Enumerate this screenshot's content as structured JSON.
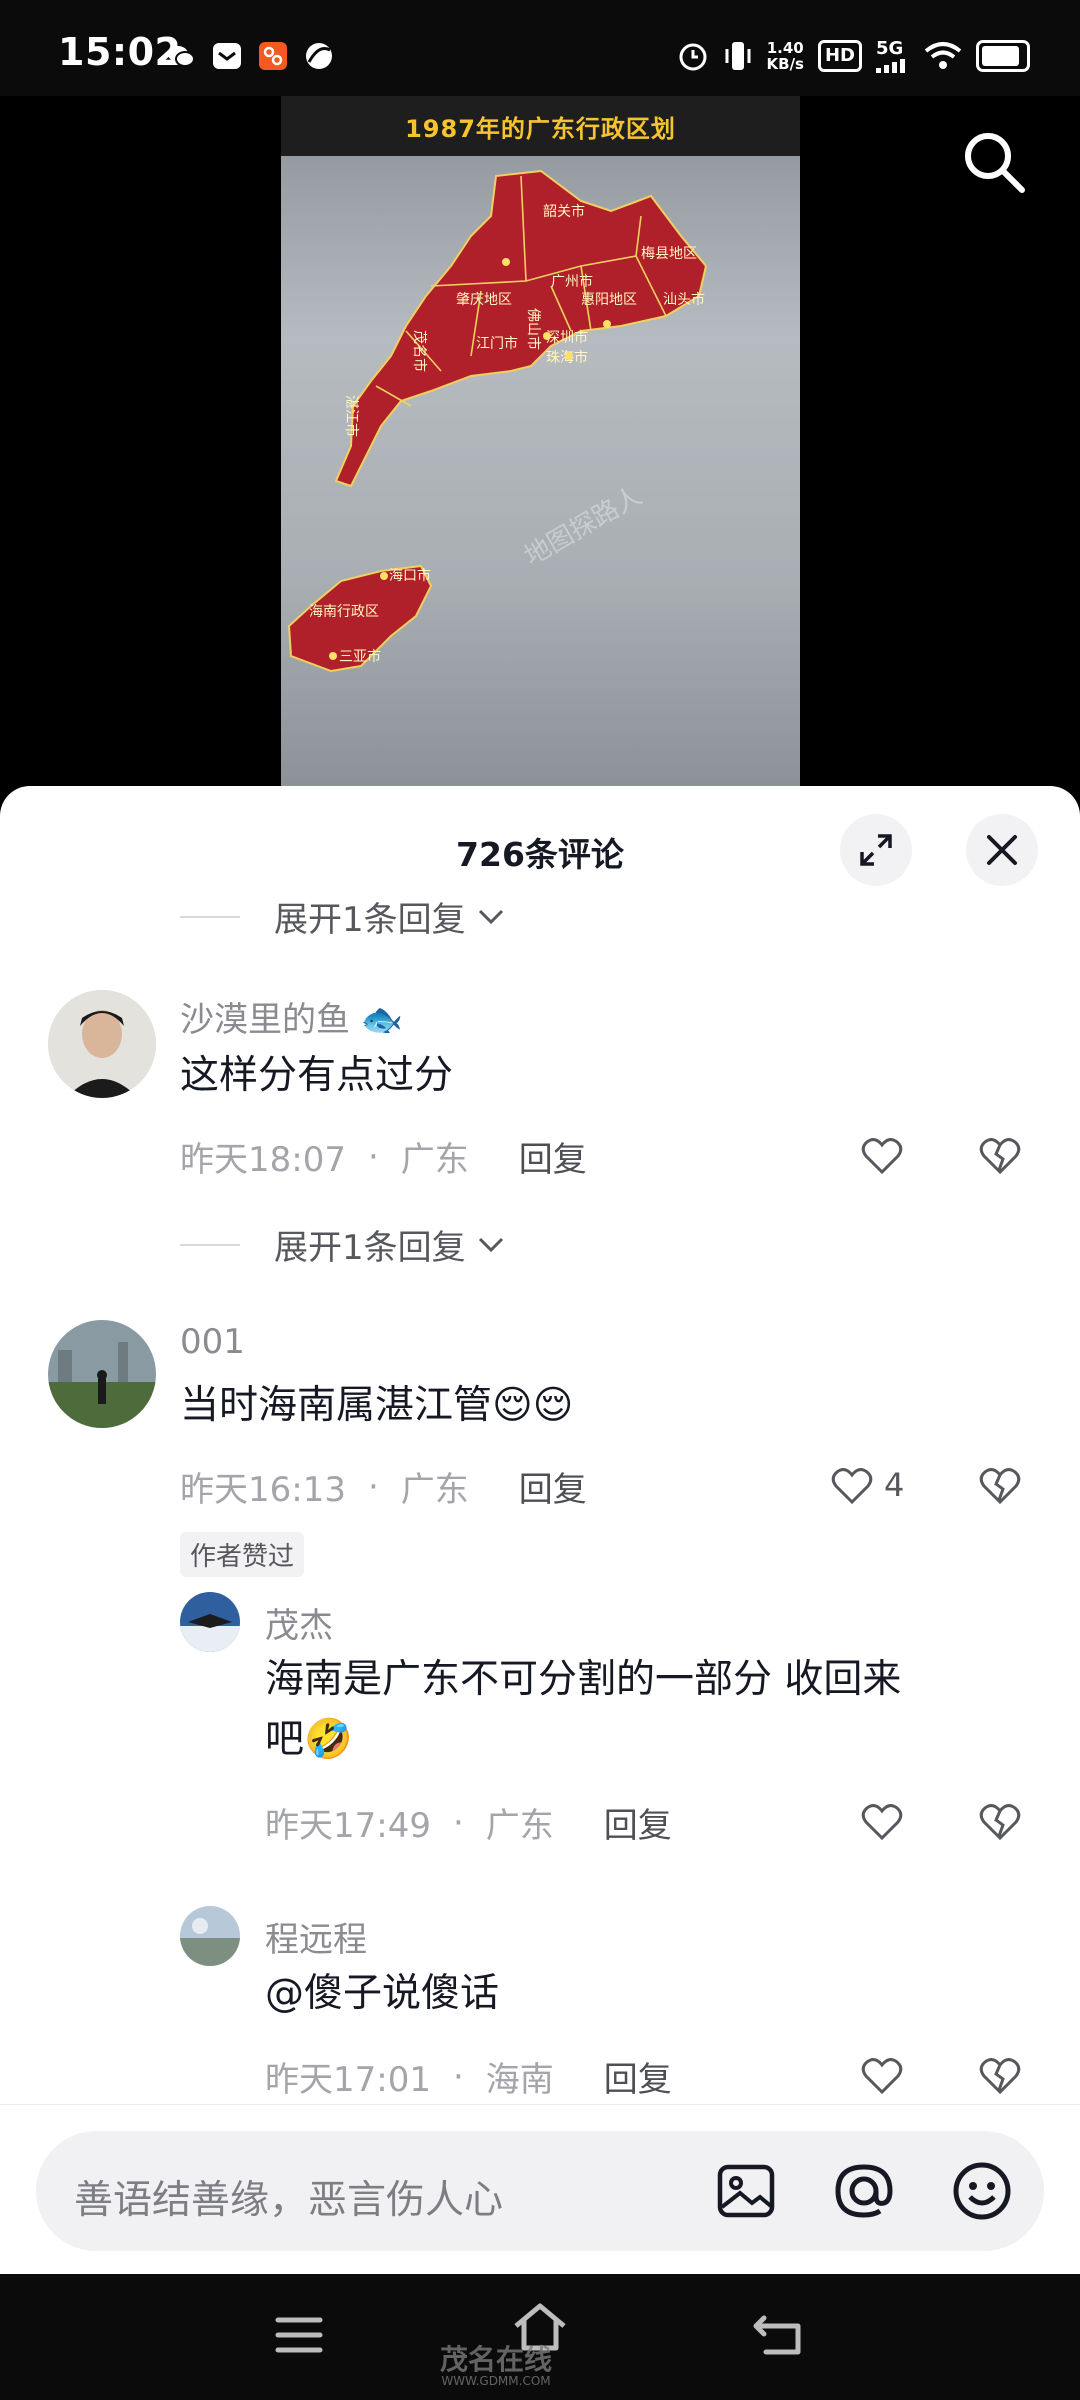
{
  "status_bar": {
    "time": "15:02",
    "net_speed": "1.40",
    "net_unit": "KB/s",
    "hd": "HD",
    "signal": "5G"
  },
  "video": {
    "map_title": "1987年的广东行政区划",
    "labels": {
      "shaoguan": "韶关市",
      "meixian": "梅县地区",
      "guangzhou": "广州市",
      "zhaoqing": "肇庆地区",
      "foshan": "佛山市",
      "huiyang": "惠阳地区",
      "shantou": "汕头市",
      "maoming": "茂名市",
      "jiangmen": "江门市",
      "shenzhen": "深圳市",
      "zhuhai": "珠海市",
      "zhanjiang": "湛江市",
      "haikou": "海口市",
      "hainan": "海南行政区",
      "sanya": "三亚市"
    },
    "watermark": "地图探路人"
  },
  "comments_sheet": {
    "title": "726条评论",
    "expand_label": "展开1条回复",
    "reply_label": "回复",
    "comments": [
      {
        "name": "沙漠里的鱼",
        "text": "这样分有点过分",
        "time": "昨天18:07",
        "location": "广东"
      },
      {
        "name": "001",
        "text": "当时海南属湛江管",
        "emoji": "😌😌",
        "time": "昨天16:13",
        "location": "广东",
        "likes": "4",
        "tag": "作者赞过"
      }
    ],
    "replies": [
      {
        "name": "茂杰",
        "text_line1": "海南是广东不可分割的一部分 收回来",
        "text_line2": "吧",
        "emoji": "🤣",
        "time": "昨天17:49",
        "location": "广东"
      },
      {
        "name": "程远程",
        "text": "@傻子说傻话",
        "time": "昨天17:01",
        "location": "海南"
      }
    ]
  },
  "input_bar": {
    "placeholder": "善语结善缘，恶言伤人心"
  },
  "nav_watermark": {
    "name": "茂名在线",
    "url": "WWW.GDMM.COM"
  },
  "colors": {
    "map_red": "#b0202a",
    "map_border": "#f0d060",
    "accent_text": "#161823"
  }
}
